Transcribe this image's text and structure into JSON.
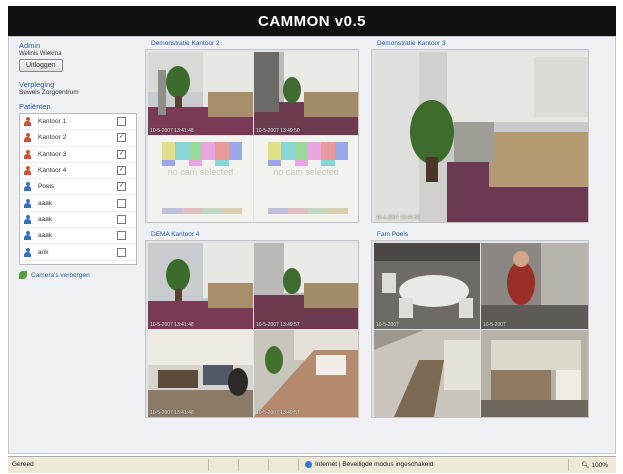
{
  "app": {
    "title": "CAMMON v0.5"
  },
  "sidebar": {
    "admin": {
      "title": "Admin",
      "username": "Wellnis Wiekma",
      "logout_label": "Uitloggen"
    },
    "nursing": {
      "title": "Verpleging",
      "group": "Sewels Zorgcentrum"
    },
    "patients": {
      "title": "Patiënten",
      "items": [
        {
          "label": "Kantoor 1",
          "checked": false,
          "color": "#d05040"
        },
        {
          "label": "Kantoor 2",
          "checked": true,
          "color": "#d05040"
        },
        {
          "label": "Kantoor 3",
          "checked": true,
          "color": "#d05040"
        },
        {
          "label": "Kantoor 4",
          "checked": true,
          "color": "#d05040"
        },
        {
          "label": "Poels",
          "checked": true,
          "color": "#3a6fc0"
        },
        {
          "label": "aaak",
          "checked": false,
          "color": "#3a6fc0"
        },
        {
          "label": "aaak",
          "checked": false,
          "color": "#3a6fc0"
        },
        {
          "label": "aaak",
          "checked": false,
          "color": "#3a6fc0"
        },
        {
          "label": "arik",
          "checked": false,
          "color": "#3a6fc0"
        }
      ],
      "check_mark": "✓"
    },
    "hide_cameras_label": "Camera's verbergen"
  },
  "panels": [
    {
      "title": "Demonstratie Kantoor 2",
      "cams": [
        "10-5-2007 13:41:48",
        "10-5-2007 13:49:50"
      ],
      "nocam_text": "no cam selected"
    },
    {
      "title": "Demonstratie Kantoor 3",
      "cams": [
        "10-5-2007 13:49:50"
      ]
    },
    {
      "title": "DEMA Kantoor 4",
      "cams": [
        "10-5-2007 13:41:48",
        "10-5-2007 13:49:57",
        "10-5-2007 13:41:48",
        "10-5-2007 13:49:57"
      ]
    },
    {
      "title": "Fam Poels",
      "cams": [
        "10-5-2007",
        "10-5-2007",
        "",
        ""
      ]
    }
  ],
  "status": {
    "left": "Gereed",
    "zone": "Internet | Beveiligde modus ingeschakeld",
    "zoom": "100%"
  },
  "colors": {
    "title_bg": "#111111",
    "link": "#2a5db0",
    "content_bg": "#eef0f4"
  }
}
